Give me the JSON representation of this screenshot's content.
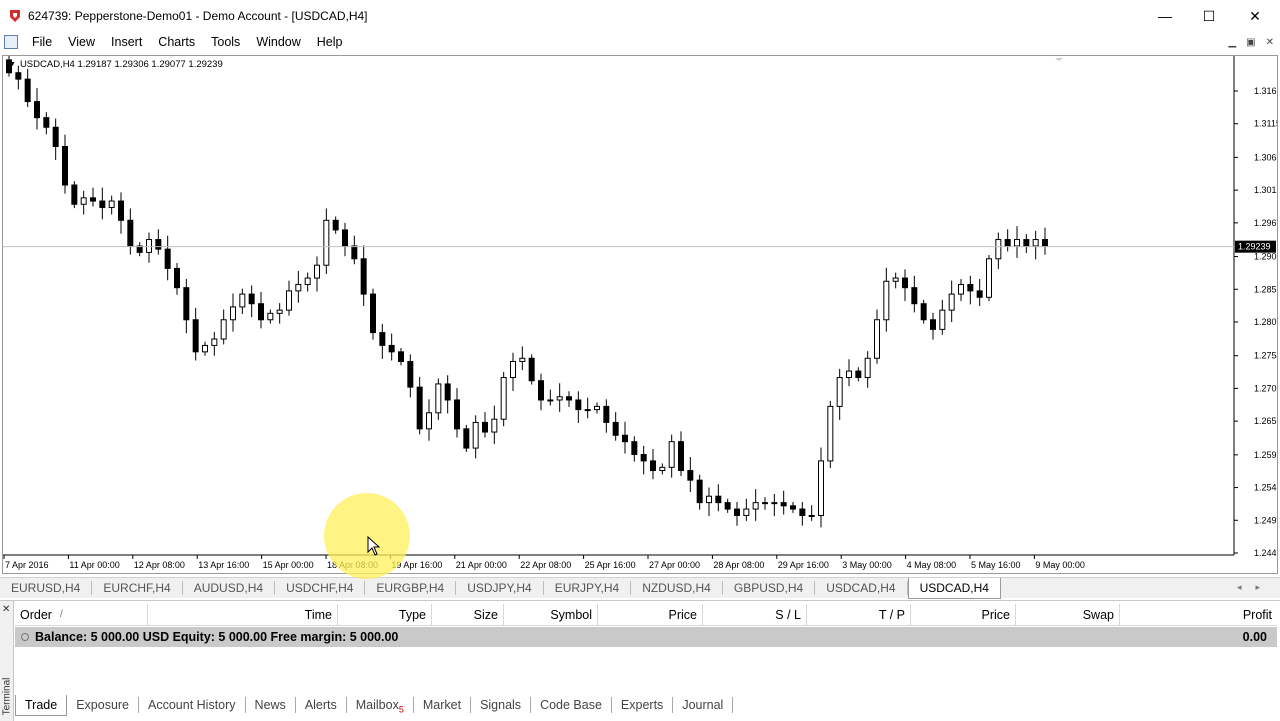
{
  "window": {
    "title": "624739: Pepperstone-Demo01 - Demo Account - [USDCAD,H4]",
    "minimize": "—",
    "maximize": "☐",
    "close": "✕"
  },
  "menu": [
    "File",
    "View",
    "Insert",
    "Charts",
    "Tools",
    "Window",
    "Help"
  ],
  "mdi_buttons": [
    "▁",
    "▣",
    "✕"
  ],
  "chart": {
    "header": "USDCAD,H4  1.29187 1.29306 1.29077 1.29239",
    "current_price": "1.29239",
    "price_labels": [
      "1.31665",
      "1.31155",
      "1.30630",
      "1.30120",
      "1.29610",
      "1.29085",
      "1.28575",
      "1.28065",
      "1.27540",
      "1.27030",
      "1.26520",
      "1.25995",
      "1.25485",
      "1.24975",
      "1.24465"
    ],
    "time_labels": [
      "7 Apr 2016",
      "11 Apr 00:00",
      "12 Apr 08:00",
      "13 Apr 16:00",
      "15 Apr 00:00",
      "18 Apr 08:00",
      "19 Apr 16:00",
      "21 Apr 00:00",
      "22 Apr 08:00",
      "25 Apr 16:00",
      "27 Apr 00:00",
      "28 Apr 08:00",
      "29 Apr 16:00",
      "3 May 00:00",
      "4 May 08:00",
      "5 May 16:00",
      "9 May 00:00"
    ],
    "colors": {
      "bull": "#ffffff",
      "bear": "#000000",
      "wick": "#000000",
      "bid_line": "#c0c0c0"
    }
  },
  "chart_data": {
    "type": "candlestick",
    "symbol": "USDCAD",
    "timeframe": "H4",
    "ylim": [
      1.24465,
      1.31665
    ],
    "close_path": [
      1.3195,
      1.3185,
      1.315,
      1.3125,
      1.311,
      1.308,
      1.302,
      1.299,
      1.3,
      1.2995,
      1.2985,
      1.2995,
      1.2965,
      1.2925,
      1.2915,
      1.2935,
      1.292,
      1.289,
      1.286,
      1.281,
      1.276,
      1.277,
      1.278,
      1.281,
      1.283,
      1.285,
      1.2835,
      1.281,
      1.282,
      1.2825,
      1.2855,
      1.2865,
      1.2875,
      1.2895,
      1.2965,
      1.295,
      1.2925,
      1.2905,
      1.285,
      1.279,
      1.277,
      1.276,
      1.2745,
      1.2705,
      1.264,
      1.2665,
      1.271,
      1.2685,
      1.264,
      1.261,
      1.265,
      1.2635,
      1.2655,
      1.272,
      1.2745,
      1.275,
      1.2715,
      1.2685,
      1.2685,
      1.269,
      1.2685,
      1.267,
      1.267,
      1.2675,
      1.265,
      1.263,
      1.262,
      1.26,
      1.259,
      1.2575,
      1.258,
      1.262,
      1.2575,
      1.256,
      1.2525,
      1.2535,
      1.2525,
      1.2515,
      1.2505,
      1.2515,
      1.2525,
      1.2525,
      1.2525,
      1.252,
      1.2515,
      1.2505,
      1.2505,
      1.259,
      1.2675,
      1.272,
      1.273,
      1.272,
      1.275,
      1.281,
      1.287,
      1.2875,
      1.286,
      1.2835,
      1.281,
      1.2795,
      1.2825,
      1.285,
      1.2865,
      1.2855,
      1.2845,
      1.2905,
      1.2935,
      1.2925,
      1.2935,
      1.2925,
      1.2935,
      1.2925
    ]
  },
  "symbol_tabs": [
    "EURUSD,H4",
    "EURCHF,H4",
    "AUDUSD,H4",
    "USDCHF,H4",
    "EURGBP,H4",
    "USDJPY,H4",
    "EURJPY,H4",
    "NZDUSD,H4",
    "GBPUSD,H4",
    "USDCAD,H4",
    "USDCAD,H4"
  ],
  "symbol_tab_arrows": [
    "◂",
    "▸"
  ],
  "terminal": {
    "side_label": "Terminal",
    "close": "✕",
    "columns": [
      "Order",
      "/",
      "Time",
      "Type",
      "Size",
      "Symbol",
      "Price",
      "S / L",
      "T / P",
      "Price",
      "Swap",
      "Profit"
    ],
    "balance_text": "Balance: 5 000.00 USD  Equity: 5 000.00  Free margin: 5 000.00",
    "balance_profit": "0.00",
    "tabs": [
      "Trade",
      "Exposure",
      "Account History",
      "News",
      "Alerts",
      "Mailbox",
      "Market",
      "Signals",
      "Code Base",
      "Experts",
      "Journal"
    ],
    "mailbox_badge": "5"
  }
}
